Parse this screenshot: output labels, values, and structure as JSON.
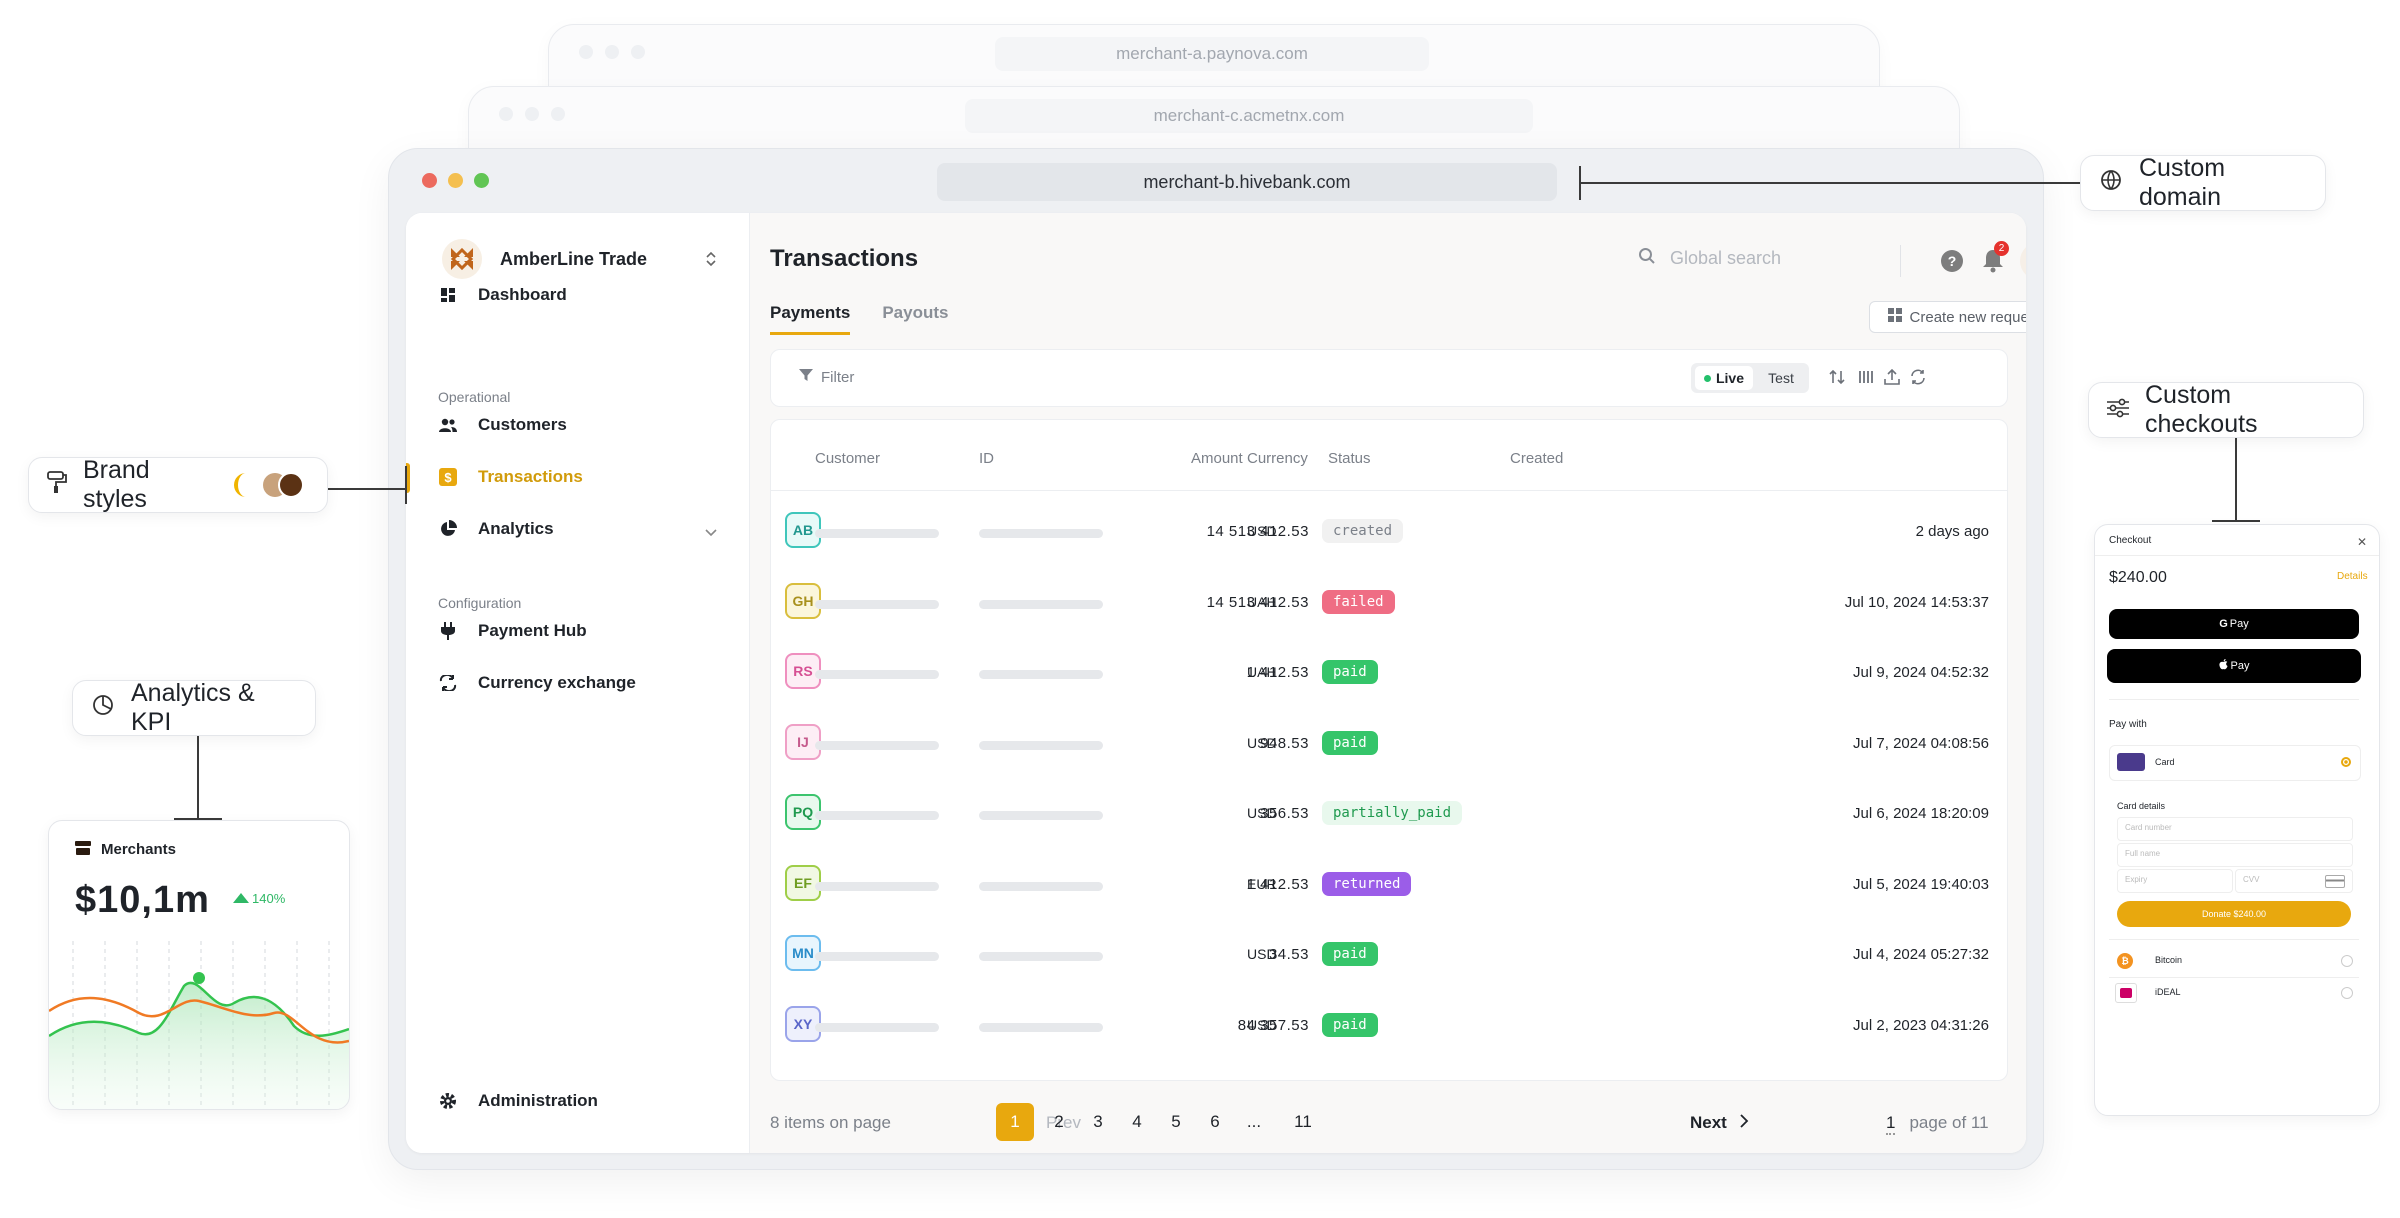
{
  "background_windows": [
    {
      "url": "merchant-a.paynova.com"
    },
    {
      "url": "merchant-c.acmetnx.com"
    }
  ],
  "window": {
    "url": "merchant-b.hivebank.com"
  },
  "sidebar": {
    "brand_name": "AmberLine Trade",
    "dashboard": "Dashboard",
    "section_operational": "Operational",
    "customers": "Customers",
    "transactions": "Transactions",
    "analytics": "Analytics",
    "section_configuration": "Configuration",
    "payment_hub": "Payment Hub",
    "currency_exchange": "Currency exchange",
    "administration": "Administration"
  },
  "header": {
    "title": "Transactions",
    "search_placeholder": "Global search",
    "notification_count": "2"
  },
  "tabs": {
    "payments": "Payments",
    "payouts": "Payouts"
  },
  "create_request_label": "Create new request",
  "toolbar": {
    "filter": "Filter",
    "live": "Live",
    "test": "Test"
  },
  "table": {
    "headers": {
      "customer": "Customer",
      "id": "ID",
      "amount": "Amount",
      "currency": "Currency",
      "status": "Status",
      "created": "Created"
    },
    "rows": [
      {
        "initials": "AB",
        "amount": "14 513 412.53",
        "currency": "USD",
        "status": "created",
        "created": "2 days ago"
      },
      {
        "initials": "GH",
        "amount": "14 513 412.53",
        "currency": "UAH",
        "status": "failed",
        "created": "Jul 10, 2024 14:53:37"
      },
      {
        "initials": "RS",
        "amount": "1 412.53",
        "currency": "UAH",
        "status": "paid",
        "created": "Jul 9, 2024 04:52:32"
      },
      {
        "initials": "IJ",
        "amount": "948.53",
        "currency": "USD",
        "status": "paid",
        "created": "Jul 7, 2024 04:08:56"
      },
      {
        "initials": "PQ",
        "amount": "356.53",
        "currency": "USD",
        "status": "partially_paid",
        "created": "Jul 6, 2024 18:20:09"
      },
      {
        "initials": "EF",
        "amount": "1 412.53",
        "currency": "EUR",
        "status": "returned",
        "created": "Jul 5, 2024 19:40:03"
      },
      {
        "initials": "MN",
        "amount": "34.53",
        "currency": "USD",
        "status": "paid",
        "created": "Jul 4, 2024 05:27:32"
      },
      {
        "initials": "XY",
        "amount": "84 357.53",
        "currency": "USD",
        "status": "paid",
        "created": "Jul 2, 2023 04:31:26"
      }
    ]
  },
  "pagination": {
    "items_info": "8 items on page",
    "prev": "Prev",
    "pages": [
      "1",
      "2",
      "3",
      "4",
      "5",
      "6",
      "...",
      "11"
    ],
    "current": "1",
    "next": "Next",
    "page_of": "page of 11"
  },
  "callouts": {
    "custom_domain": "Custom domain",
    "brand_styles": "Brand styles",
    "analytics_kpi": "Analytics & KPI",
    "custom_checkouts": "Custom checkouts"
  },
  "analytics_card": {
    "title": "Merchants",
    "value": "$10,1m",
    "change": "140%"
  },
  "checkout": {
    "title": "Checkout",
    "amount": "$240.00",
    "details_link": "Details",
    "gpay": "Pay",
    "apple_pay": "Pay",
    "pay_with": "Pay with",
    "card": "Card",
    "card_details": "Card details",
    "card_number": "Card number",
    "full_name": "Full name",
    "expiry": "Expiry",
    "cvv": "CVV",
    "donate": "Donate $240.00",
    "bitcoin": "Bitcoin",
    "ideal": "iDEAL"
  },
  "colors": {
    "accent": "#e8a80e",
    "brand_swatches": [
      "#f0b400",
      "#c8a27c",
      "#5b3214"
    ]
  }
}
